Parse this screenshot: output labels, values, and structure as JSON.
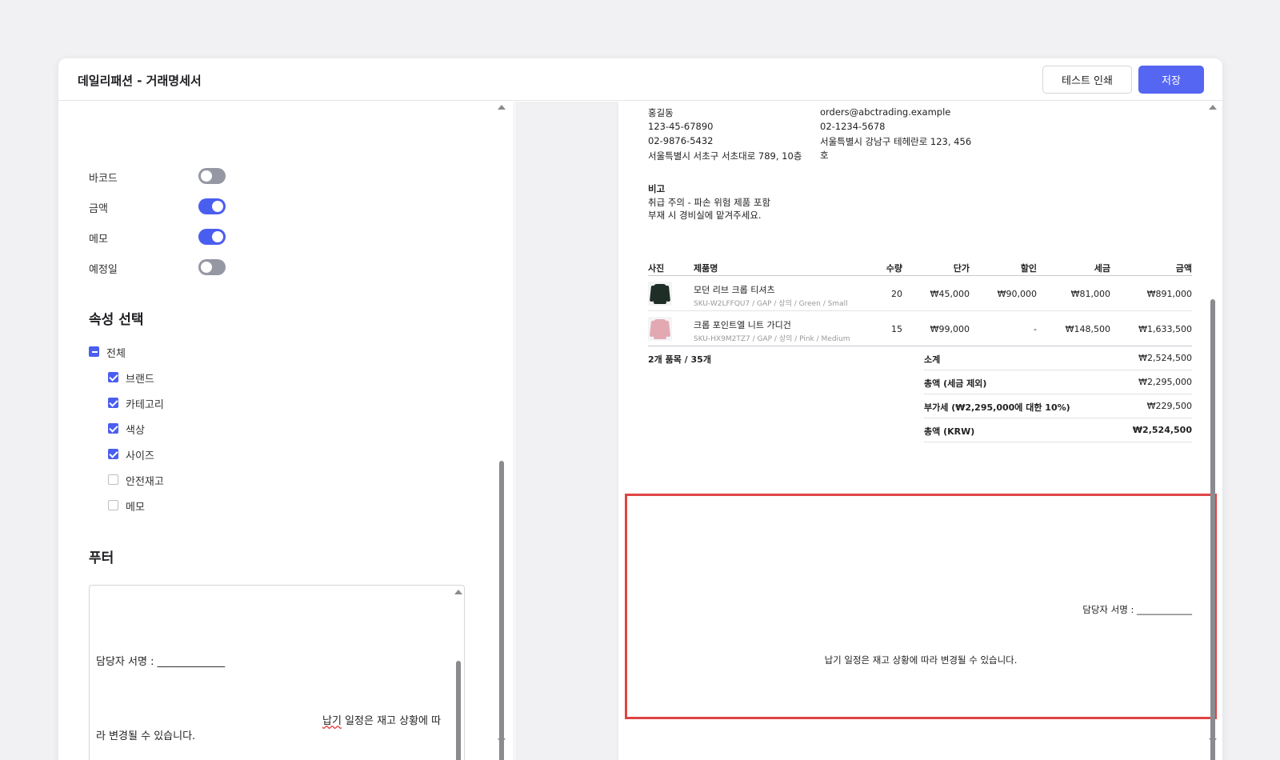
{
  "header": {
    "title": "데일리패션 - 거래명세서",
    "test_print_label": "테스트 인쇄",
    "save_label": "저장"
  },
  "toggles": [
    {
      "label": "바코드",
      "on": false
    },
    {
      "label": "금액",
      "on": true
    },
    {
      "label": "메모",
      "on": true
    },
    {
      "label": "예정일",
      "on": false
    }
  ],
  "attributes": {
    "heading": "속성 선택",
    "all_label": "전체",
    "items": [
      {
        "label": "브랜드",
        "checked": true
      },
      {
        "label": "카테고리",
        "checked": true
      },
      {
        "label": "색상",
        "checked": true
      },
      {
        "label": "사이즈",
        "checked": true
      },
      {
        "label": "안전재고",
        "checked": false
      },
      {
        "label": "메모",
        "checked": false
      }
    ]
  },
  "footer_section": {
    "heading": "푸터",
    "signature_line": "담당자 서명 :    _____________",
    "note_part1": "납기 일정은 재고 상황에 따",
    "note_part1_misspelled": "납기",
    "note_part1_rest": " 일정은 재고 상황에 따",
    "note_part2": "라 변경될 수 있습니다."
  },
  "preview": {
    "seller": {
      "name": "홍길동",
      "reg_no": "123-45-67890",
      "phone": "02-9876-5432",
      "address": "서울특별시 서초구 서초대로 789, 10층"
    },
    "buyer": {
      "email": "orders@abctrading.example",
      "phone": "02-1234-5678",
      "address_line1": "서울특별시 강남구 테헤란로 123, 456",
      "address_line2": "호"
    },
    "remarks": {
      "label": "비고",
      "line1": "취급 주의 - 파손 위험 제품 포함",
      "line2": "부재 시 경비실에 맡겨주세요."
    },
    "table": {
      "headers": [
        "사진",
        "제품명",
        "수량",
        "단가",
        "할인",
        "세금",
        "금액"
      ],
      "rows": [
        {
          "name": "모던 리브 크롭 티셔츠",
          "sku": "SKU-W2LFFQU7 / GAP / 상의 / Green / Small",
          "qty": "20",
          "unit_price": "₩45,000",
          "discount": "₩90,000",
          "tax": "₩81,000",
          "amount": "₩891,000",
          "color": "#1f2d27"
        },
        {
          "name": "크롭 포인트엘 니트 가디건",
          "sku": "SKU-HX9M2TZ7 / GAP / 상의 / Pink / Medium",
          "qty": "15",
          "unit_price": "₩99,000",
          "discount": "-",
          "tax": "₩148,500",
          "amount": "₩1,633,500",
          "color": "#e3a9b3"
        }
      ]
    },
    "count_summary": "2개 품목 / 35개",
    "summary": [
      {
        "label": "소계",
        "value": "₩2,524,500"
      },
      {
        "label": "총액 (세금 제외)",
        "value": "₩2,295,000"
      },
      {
        "label": "부가세 (₩2,295,000에 대한 10%)",
        "value": "₩229,500"
      },
      {
        "label": "총액 (KRW)",
        "value": "₩2,524,500"
      }
    ],
    "footer": {
      "signature": "담당자 서명 :    ____________",
      "note": "납기 일정은 재고 상황에 따라 변경될 수 있습니다."
    }
  },
  "colors": {
    "accent": "#4a5ef0",
    "highlight_border": "#e04444"
  }
}
